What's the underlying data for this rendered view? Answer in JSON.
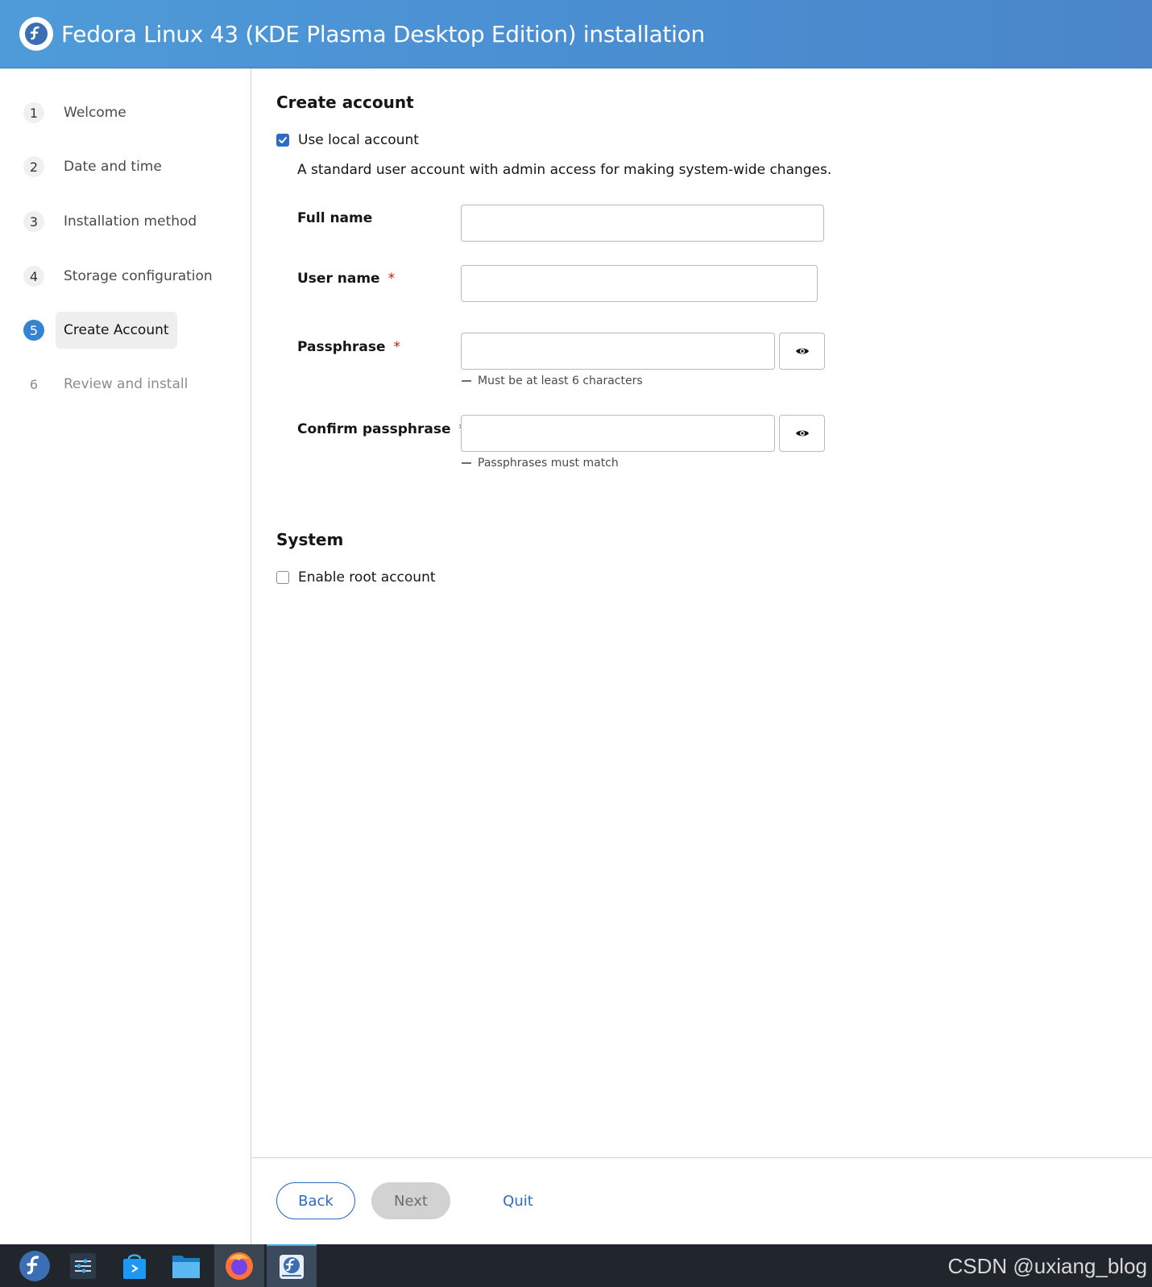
{
  "header": {
    "title": "Fedora Linux 43 (KDE Plasma Desktop Edition) installation",
    "logo_icon": "fedora-logo-icon"
  },
  "sidebar": {
    "steps": [
      {
        "num": "1",
        "label": "Welcome",
        "state": "done"
      },
      {
        "num": "2",
        "label": "Date and time",
        "state": "done"
      },
      {
        "num": "3",
        "label": "Installation method",
        "state": "done"
      },
      {
        "num": "4",
        "label": "Storage configuration",
        "state": "done"
      },
      {
        "num": "5",
        "label": "Create Account",
        "state": "current"
      },
      {
        "num": "6",
        "label": "Review and install",
        "state": "disabled"
      }
    ]
  },
  "main": {
    "create_account_title": "Create account",
    "use_local_account": {
      "label": "Use local account",
      "checked": true
    },
    "local_account_desc": "A standard user account with admin access for making system-wide changes.",
    "fields": {
      "full_name": {
        "label": "Full name",
        "value": ""
      },
      "user_name": {
        "label": "User name",
        "required": "*",
        "value": ""
      },
      "passphrase": {
        "label": "Passphrase",
        "required": "*",
        "value": "",
        "helper": "Must be at least 6 characters"
      },
      "confirm_passphrase": {
        "label": "Confirm passphrase",
        "required": "*",
        "value": "",
        "helper": "Passphrases must match"
      }
    },
    "system_title": "System",
    "enable_root": {
      "label": "Enable root account",
      "checked": false
    }
  },
  "footer": {
    "back": "Back",
    "next": "Next",
    "quit": "Quit"
  },
  "taskbar": {
    "items": [
      "fedora-launcher-icon",
      "system-settings-icon",
      "discover-store-icon",
      "file-manager-icon",
      "firefox-icon",
      "anaconda-installer-icon"
    ],
    "watermark": "CSDN @uxiang_blog"
  },
  "colors": {
    "accent": "#2b6cc4",
    "header": "#4a8fd2",
    "required": "#c9190b",
    "taskbar": "#20262b"
  }
}
